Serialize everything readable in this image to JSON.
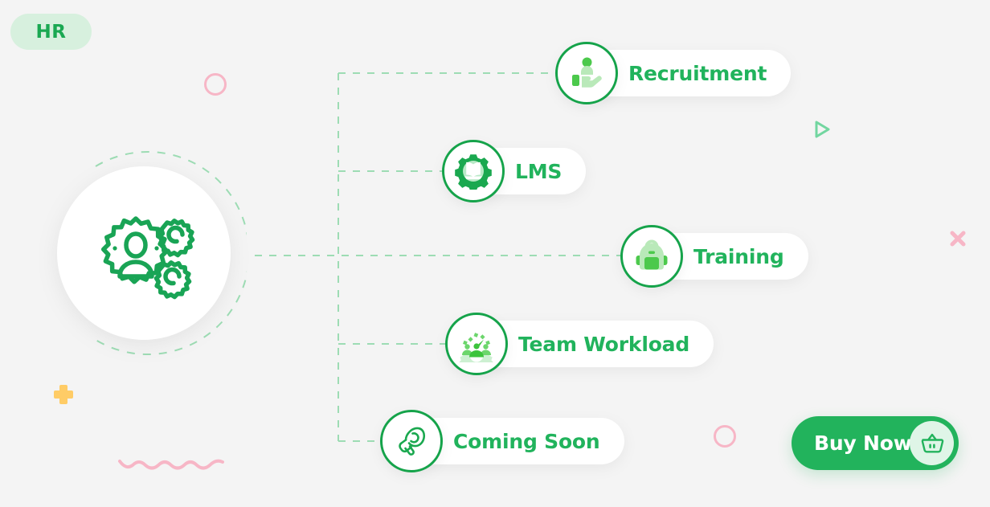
{
  "page": {
    "background_color": "#f4f4f4",
    "accent_green": "#22b35c",
    "dark_green": "#15a34a",
    "light_green": "#9fe09f",
    "pink": "#f7b6c6",
    "yellow": "#ffcc66"
  },
  "badge": {
    "label": "HR",
    "background_color": "#d7f0de",
    "text_color": "#1aa852"
  },
  "hub": {
    "icon": "hr-gears-person-icon",
    "background_color": "#ffffff"
  },
  "nodes": [
    {
      "id": "recruitment",
      "label": "Recruitment",
      "icon": "recruitment-person-in-hand-icon"
    },
    {
      "id": "lms",
      "label": "LMS",
      "icon": "gear-book-icon"
    },
    {
      "id": "training",
      "label": "Training",
      "icon": "backpack-icon"
    },
    {
      "id": "team_workload",
      "label": "Team Workload",
      "icon": "gauge-people-icon"
    },
    {
      "id": "coming_soon",
      "label": "Coming Soon",
      "icon": "megaphone-icon"
    }
  ],
  "cta": {
    "label": "Buy Now",
    "icon": "shopping-basket-icon",
    "background_color": "#22b35c",
    "text_color": "#ffffff"
  },
  "decorations": [
    {
      "id": "circle_pink_top",
      "shape": "circle-outline",
      "color": "#f7b6c6"
    },
    {
      "id": "circle_pink_bottom",
      "shape": "circle-outline",
      "color": "#f7b6c6"
    },
    {
      "id": "plus_yellow",
      "shape": "plus",
      "color": "#ffcc66"
    },
    {
      "id": "wave_pink",
      "shape": "wave",
      "color": "#f7b6c6"
    },
    {
      "id": "triangle_green",
      "shape": "triangle-outline",
      "color": "#72d6a0"
    },
    {
      "id": "cross_pink",
      "shape": "cross",
      "color": "#f7b6c6"
    }
  ]
}
